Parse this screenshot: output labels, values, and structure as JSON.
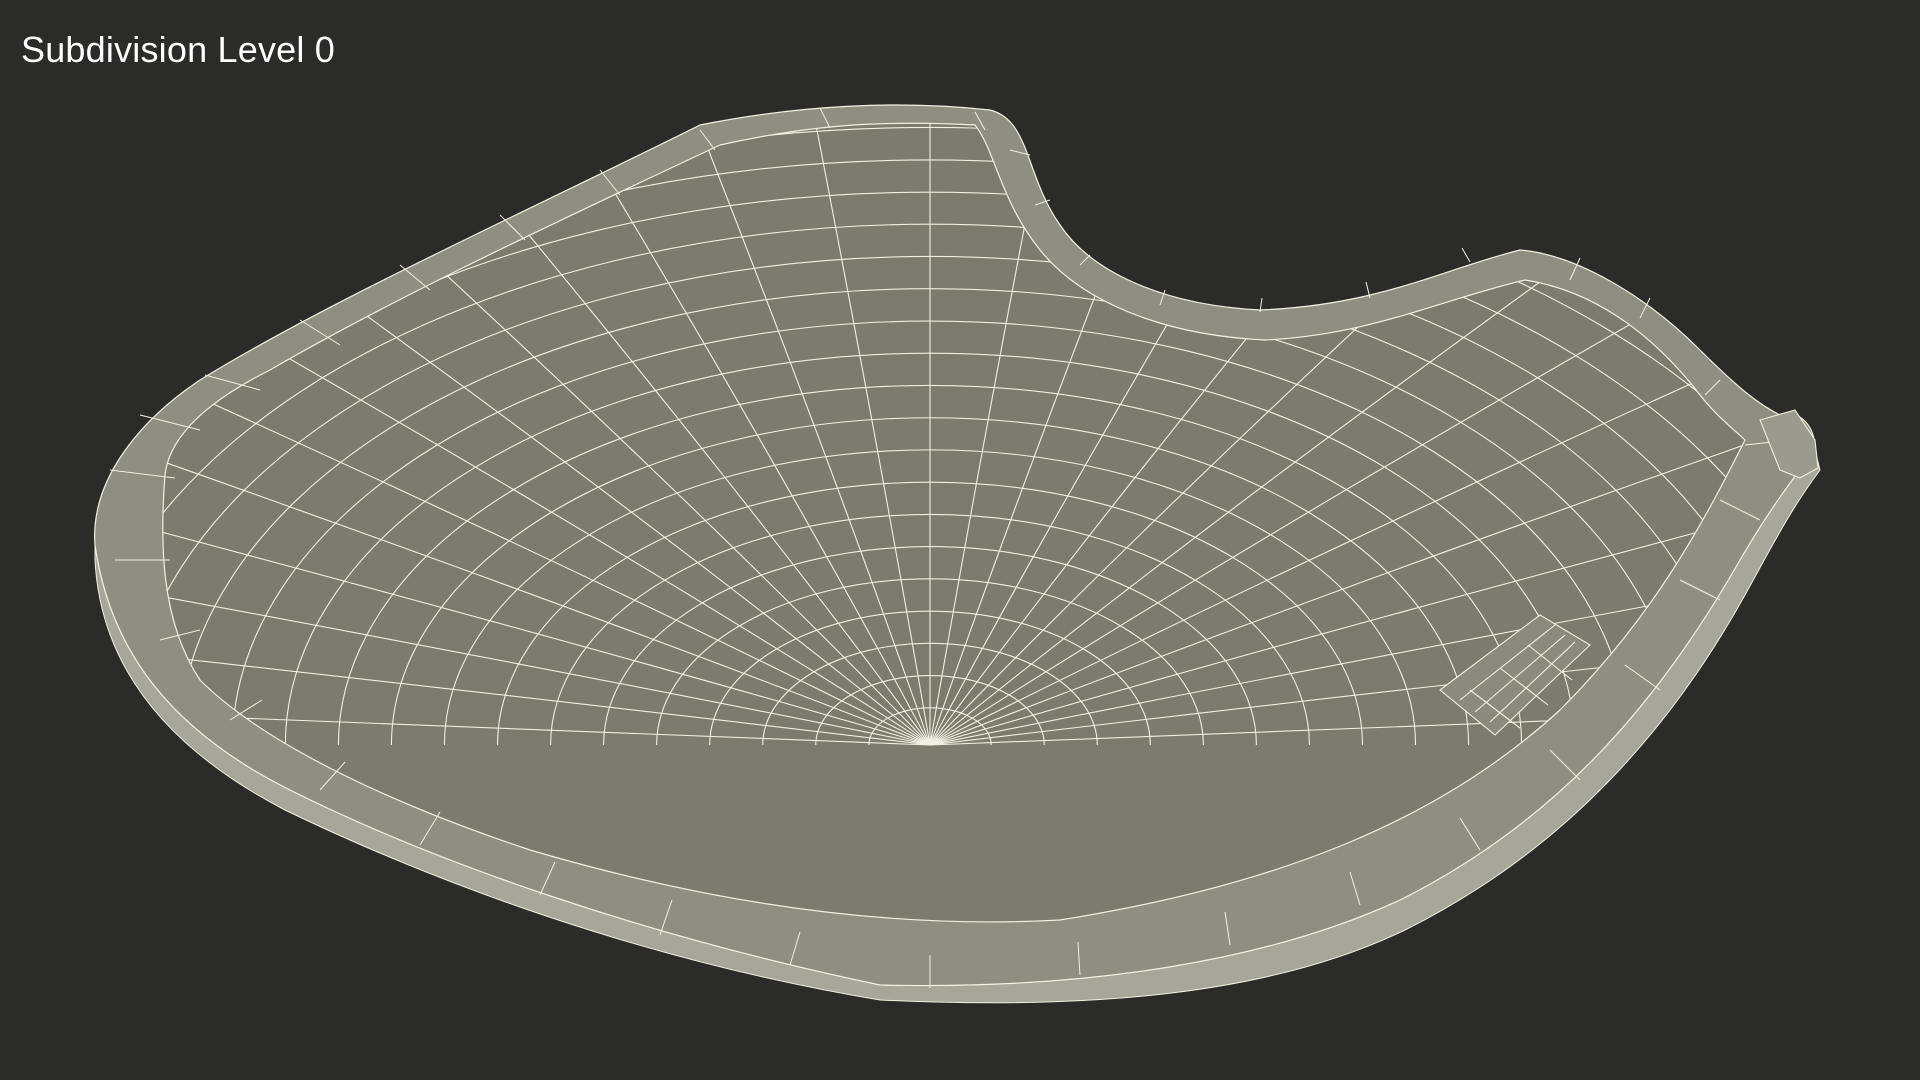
{
  "caption": "Subdivision Level 0",
  "colors": {
    "background": "#2b2b2a",
    "surface": "#7b7b70",
    "rim": "#8d8d82",
    "rim_side": "#a4a498",
    "wire": "#f2f0e0"
  },
  "subject": {
    "object": "curved tray wireframe mesh",
    "style": "wireframe render"
  }
}
